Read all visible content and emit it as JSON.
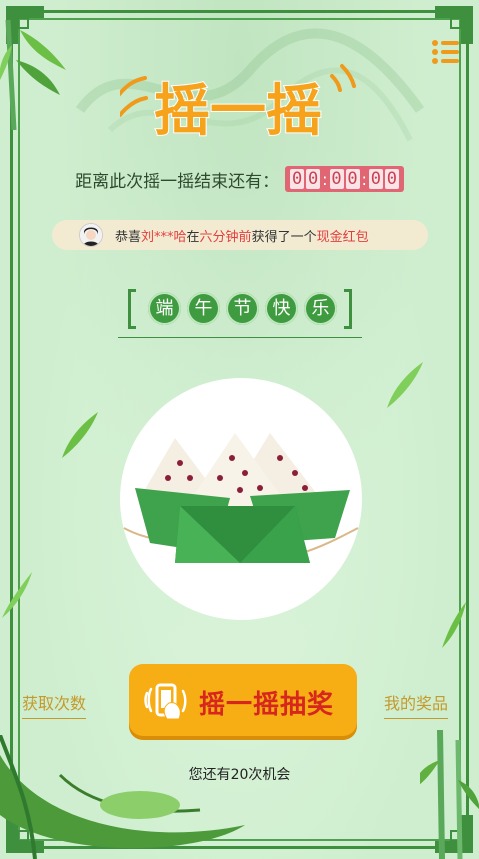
{
  "header": {
    "title": "摇一摇"
  },
  "countdown": {
    "label": "距离此次摇一摇结束还有：",
    "digits": [
      "0",
      "0",
      "0",
      "0",
      "0",
      "0"
    ]
  },
  "notice": {
    "prefix": "恭喜",
    "name": "刘***哈",
    "mid1": "在",
    "time": "六分钟前",
    "mid2": "获得了一个",
    "prize": "现金红包"
  },
  "festival": {
    "chars": [
      "端",
      "午",
      "节",
      "快",
      "乐"
    ]
  },
  "actions": {
    "left_link": "获取次数",
    "right_link": "我的奖品",
    "shake_button": "摇一摇抽奖"
  },
  "footer": {
    "chances_text": "您还有20次机会"
  },
  "colors": {
    "frame_green": "#3e8f3e",
    "button_orange": "#f6ae14",
    "button_text_red": "#d7261e",
    "title_orange": "#f7a21b",
    "link_gold": "#c49a2d",
    "countdown_red": "#e06673"
  },
  "icons": [
    "menu-icon",
    "avatar",
    "phone-shake-icon",
    "zongzi-illustration",
    "bamboo-decoration",
    "leaf-decoration",
    "frame-corner"
  ]
}
